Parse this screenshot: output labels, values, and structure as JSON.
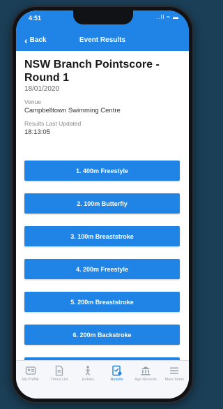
{
  "status_bar": {
    "time": "4:51",
    "icons": "..ll ≈ ▬"
  },
  "nav": {
    "back_label": "Back",
    "title": "Event Results"
  },
  "meet": {
    "title": "NSW Branch Pointscore - Round 1",
    "date": "18/01/2020",
    "venue_label": "Venue",
    "venue_value": "Campbelltown Swimming Centre",
    "updated_label": "Results Last Updated",
    "updated_value": "18:13:05"
  },
  "results": [
    {
      "label": "1. 400m Freestyle"
    },
    {
      "label": "2. 100m Butterfly"
    },
    {
      "label": "3. 100m Breaststroke"
    },
    {
      "label": "4. 200m Freestyle"
    },
    {
      "label": "5. 200m Breaststroke"
    },
    {
      "label": "6. 200m Backstroke"
    },
    {
      "label": ""
    }
  ],
  "tabs": [
    {
      "label": "My Profile",
      "icon": "id-card-icon",
      "active": false
    },
    {
      "label": "Times List",
      "icon": "document-icon",
      "active": false
    },
    {
      "label": "Entries",
      "icon": "swimmer-icon",
      "active": false
    },
    {
      "label": "Results",
      "icon": "results-icon",
      "active": true
    },
    {
      "label": "Age Records",
      "icon": "bank-icon",
      "active": false
    },
    {
      "label": "More Items",
      "icon": "menu-icon",
      "active": false
    }
  ],
  "colors": {
    "accent": "#1f84e6",
    "background": "#1b3f57"
  }
}
